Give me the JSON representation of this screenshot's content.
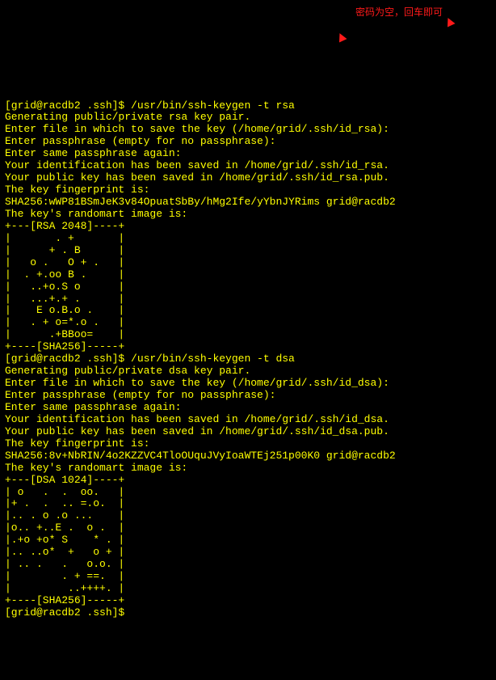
{
  "annotation": {
    "text": "密码为空，回车即可"
  },
  "terminal": {
    "lines": [
      "[grid@racdb2 .ssh]$ /usr/bin/ssh-keygen -t rsa",
      "Generating public/private rsa key pair.",
      "Enter file in which to save the key (/home/grid/.ssh/id_rsa):",
      "Enter passphrase (empty for no passphrase):",
      "Enter same passphrase again:",
      "Your identification has been saved in /home/grid/.ssh/id_rsa.",
      "Your public key has been saved in /home/grid/.ssh/id_rsa.pub.",
      "The key fingerprint is:",
      "SHA256:wWP81BSmJeK3v84OpuatSbBy/hMg2Ife/yYbnJYRims grid@racdb2",
      "The key's randomart image is:",
      "+---[RSA 2048]----+",
      "|       . +       |",
      "|      + . B      |",
      "|   o .   O + .   |",
      "|  . +.oo B .     |",
      "|   ..+o.S o      |",
      "|   ...+.+ .      |",
      "|    E o.B.o .    |",
      "|   . + o=*.o .   |",
      "|      .+BBoo=    |",
      "+----[SHA256]-----+",
      "[grid@racdb2 .ssh]$ /usr/bin/ssh-keygen -t dsa",
      "Generating public/private dsa key pair.",
      "Enter file in which to save the key (/home/grid/.ssh/id_dsa):",
      "Enter passphrase (empty for no passphrase):",
      "Enter same passphrase again:",
      "Your identification has been saved in /home/grid/.ssh/id_dsa.",
      "Your public key has been saved in /home/grid/.ssh/id_dsa.pub.",
      "The key fingerprint is:",
      "SHA256:8v+NbRIN/4o2KZZVC4TloOUquJVyIoaWTEj251p00K0 grid@racdb2",
      "The key's randomart image is:",
      "+---[DSA 1024]----+",
      "| o   .  .  oo.   |",
      "|+ .  .  .. =.o.  |",
      "|.. . o .o ...    |",
      "|o.. +..E .  o .  |",
      "|.+o +o* S    * . |",
      "|.. ..o*  +   o + |",
      "| .. .   .   o.o. |",
      "|        . + ==.  |",
      "|         ..++++. |",
      "+----[SHA256]-----+",
      "[grid@racdb2 .ssh]$"
    ]
  }
}
